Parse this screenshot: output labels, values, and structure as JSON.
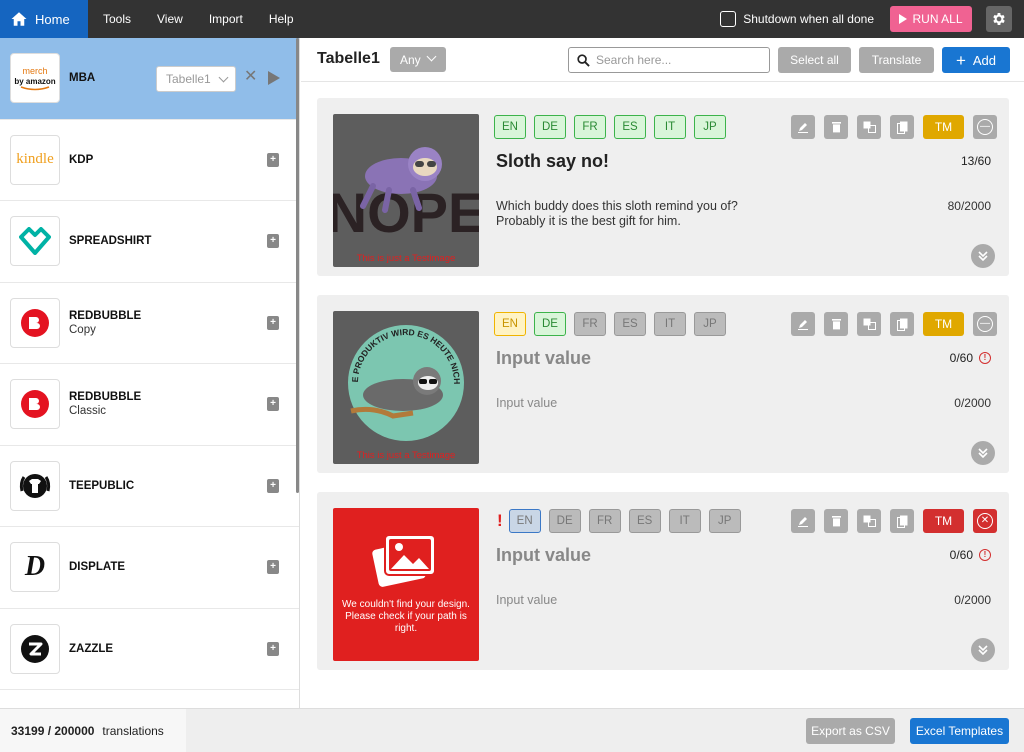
{
  "topbar": {
    "home_label": "Home",
    "menu": [
      "Tools",
      "View",
      "Import",
      "Help"
    ],
    "shutdown_label": "Shutdown when all done",
    "run_all_label": "RUN ALL"
  },
  "sidebar": {
    "selected_table": "Tabelle1",
    "platforms": [
      {
        "name": "MBA",
        "sub": "",
        "logo_text": "merch by amazon"
      },
      {
        "name": "KDP",
        "sub": "",
        "logo_text": "kindle"
      },
      {
        "name": "SPREADSHIRT",
        "sub": "",
        "logo_text": ""
      },
      {
        "name": "REDBUBBLE",
        "sub": "Copy",
        "logo_text": ""
      },
      {
        "name": "REDBUBBLE",
        "sub": "Classic",
        "logo_text": ""
      },
      {
        "name": "TEEPUBLIC",
        "sub": "",
        "logo_text": ""
      },
      {
        "name": "DISPLATE",
        "sub": "",
        "logo_text": "D"
      },
      {
        "name": "ZAZZLE",
        "sub": "",
        "logo_text": ""
      }
    ]
  },
  "header": {
    "table_name": "Tabelle1",
    "filter_value": "Any",
    "search_placeholder": "Search here...",
    "select_all_label": "Select all",
    "translate_label": "Translate",
    "add_label": "Add"
  },
  "cards": [
    {
      "langs": [
        "EN",
        "DE",
        "FR",
        "ES",
        "IT",
        "JP"
      ],
      "tm_label": "TM",
      "title": "Sloth say no!",
      "title_count": "13/60",
      "description": "Which buddy does this sloth remind you of? Probably it is the best gift for him.",
      "desc_count": "80/2000",
      "image_word": "NOPE",
      "image_caption": "This is just a Testimage"
    },
    {
      "langs": [
        "EN",
        "DE",
        "FR",
        "ES",
        "IT",
        "JP"
      ],
      "tm_label": "TM",
      "title": "Input value",
      "title_count": "0/60",
      "description": "Input value",
      "desc_count": "0/2000",
      "image_word": "ICH ATME PRODUKTIV WIRD ES HEUTE NICHT MEHR",
      "image_caption": "This is just a Testimage"
    },
    {
      "langs": [
        "EN",
        "DE",
        "FR",
        "ES",
        "IT",
        "JP"
      ],
      "tm_label": "TM",
      "title": "Input value",
      "title_count": "0/60",
      "description": "Input value",
      "desc_count": "0/2000",
      "image_error": "We couldn't find your design. Please check if your path is right."
    }
  ],
  "footer": {
    "count": "33199 / 200000",
    "count_label": "translations",
    "export_label": "Export as CSV",
    "templates_label": "Excel Templates"
  },
  "colors": {
    "primary": "#1976d2",
    "topbar": "#333333",
    "active_row": "#90bde9",
    "run_all": "#f06292",
    "tm_gold": "#e0a800",
    "error_red": "#d32f2f",
    "lang_ok": "#3cb34a"
  }
}
